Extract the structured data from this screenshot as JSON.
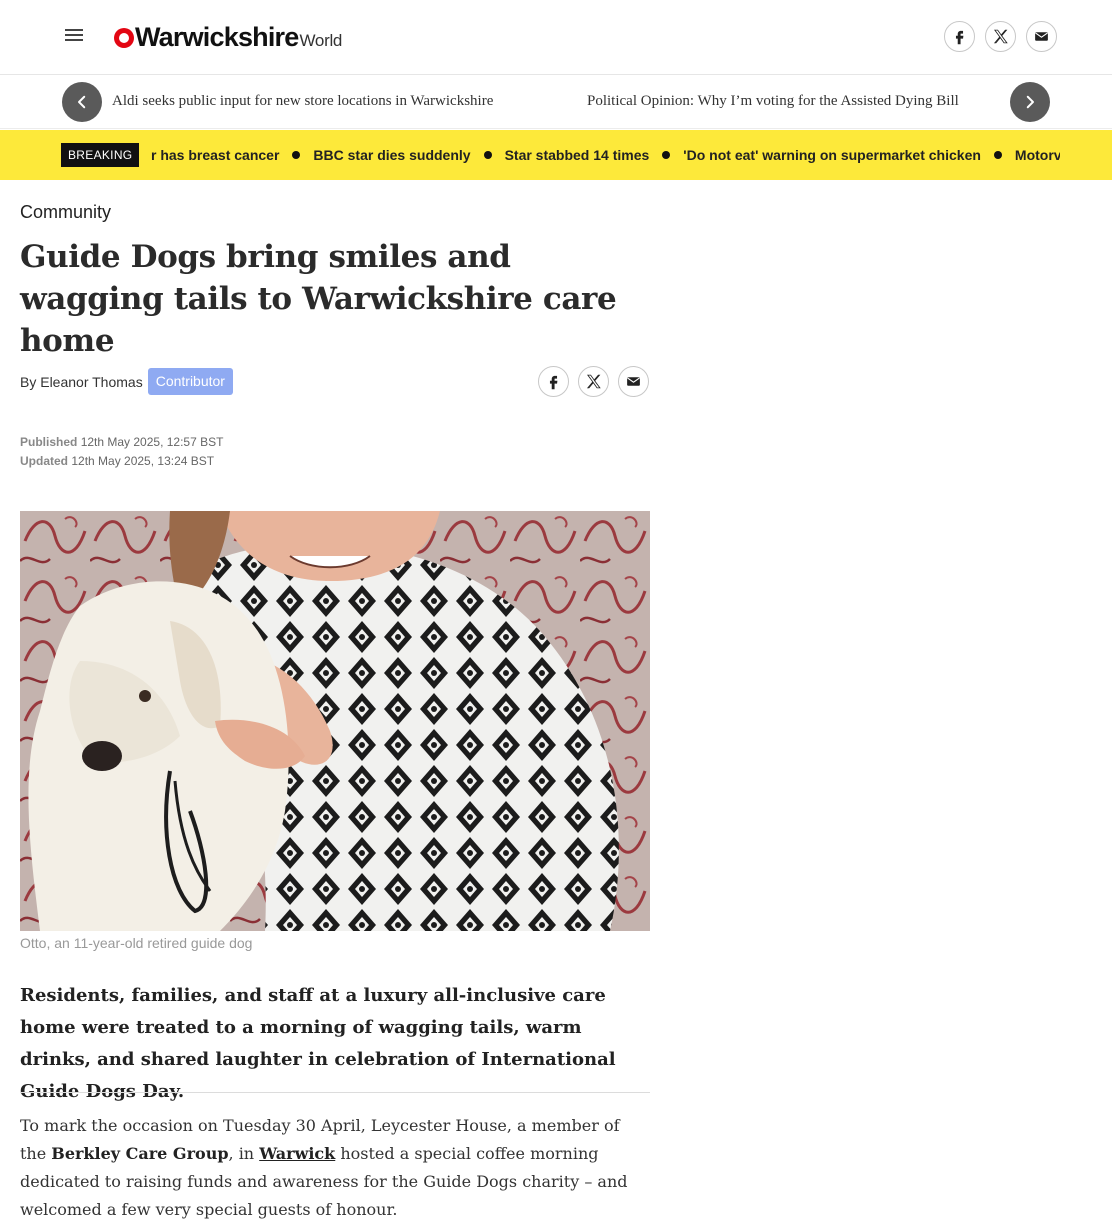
{
  "header": {
    "logo_main": "Warwickshire",
    "logo_sub": "World",
    "menu_icon": "hamburger-menu-icon",
    "share_icons": [
      "facebook-icon",
      "x-icon",
      "email-icon"
    ]
  },
  "related": {
    "items": [
      "Aldi seeks public input for new store locations in Warwickshire",
      "Political Opinion: Why I’m voting for the Assisted Dying Bill"
    ]
  },
  "breaking": {
    "label": "BREAKING",
    "items": [
      "r has breast cancer",
      "BBC star dies suddenly",
      "Star stabbed 14 times",
      "'Do not eat' warning on supermarket chicken",
      "Motorv"
    ]
  },
  "article": {
    "section": "Community",
    "headline": "Guide Dogs bring smiles and wagging tails to Warwickshire care home",
    "byline_prefix": "By",
    "author": "Eleanor Thomas",
    "author_badge": "Contributor",
    "published_label": "Published",
    "published": "12th May 2025, 12:57 BST",
    "updated_label": "Updated",
    "updated": "12th May 2025, 13:24 BST",
    "caption": "Otto, an 11-year-old retired guide dog",
    "standfirst": "Residents, families, and staff at a luxury all-inclusive care home were treated to a morning of wagging tails, warm drinks, and shared laughter in celebration of International Guide Dogs Day.",
    "body": {
      "p1_a": "To mark the occasion on Tuesday 30 April, Leycester House, a member of the ",
      "p1_bold": "Berkley Care Group",
      "p1_b": ", in ",
      "p1_link": "Warwick",
      "p1_c": " hosted a special coffee morning dedicated to raising funds and awareness for the Guide Dogs charity – and welcomed a few very special guests of honour."
    }
  },
  "colors": {
    "brand_red": "#e30613",
    "breaking_bar": "#fde93a",
    "badge": "#8faaf2",
    "arrow_button": "#5a5a5a"
  }
}
